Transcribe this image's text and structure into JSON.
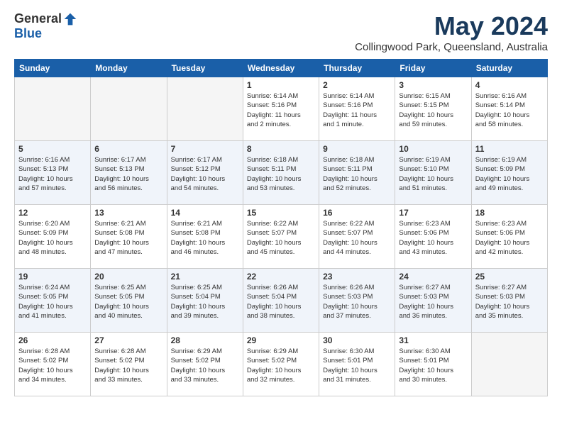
{
  "header": {
    "logo_general": "General",
    "logo_blue": "Blue",
    "month_title": "May 2024",
    "location": "Collingwood Park, Queensland, Australia"
  },
  "weekdays": [
    "Sunday",
    "Monday",
    "Tuesday",
    "Wednesday",
    "Thursday",
    "Friday",
    "Saturday"
  ],
  "weeks": [
    {
      "days": [
        {
          "num": "",
          "info": ""
        },
        {
          "num": "",
          "info": ""
        },
        {
          "num": "",
          "info": ""
        },
        {
          "num": "1",
          "info": "Sunrise: 6:14 AM\nSunset: 5:16 PM\nDaylight: 11 hours\nand 2 minutes."
        },
        {
          "num": "2",
          "info": "Sunrise: 6:14 AM\nSunset: 5:16 PM\nDaylight: 11 hours\nand 1 minute."
        },
        {
          "num": "3",
          "info": "Sunrise: 6:15 AM\nSunset: 5:15 PM\nDaylight: 10 hours\nand 59 minutes."
        },
        {
          "num": "4",
          "info": "Sunrise: 6:16 AM\nSunset: 5:14 PM\nDaylight: 10 hours\nand 58 minutes."
        }
      ]
    },
    {
      "days": [
        {
          "num": "5",
          "info": "Sunrise: 6:16 AM\nSunset: 5:13 PM\nDaylight: 10 hours\nand 57 minutes."
        },
        {
          "num": "6",
          "info": "Sunrise: 6:17 AM\nSunset: 5:13 PM\nDaylight: 10 hours\nand 56 minutes."
        },
        {
          "num": "7",
          "info": "Sunrise: 6:17 AM\nSunset: 5:12 PM\nDaylight: 10 hours\nand 54 minutes."
        },
        {
          "num": "8",
          "info": "Sunrise: 6:18 AM\nSunset: 5:11 PM\nDaylight: 10 hours\nand 53 minutes."
        },
        {
          "num": "9",
          "info": "Sunrise: 6:18 AM\nSunset: 5:11 PM\nDaylight: 10 hours\nand 52 minutes."
        },
        {
          "num": "10",
          "info": "Sunrise: 6:19 AM\nSunset: 5:10 PM\nDaylight: 10 hours\nand 51 minutes."
        },
        {
          "num": "11",
          "info": "Sunrise: 6:19 AM\nSunset: 5:09 PM\nDaylight: 10 hours\nand 49 minutes."
        }
      ]
    },
    {
      "days": [
        {
          "num": "12",
          "info": "Sunrise: 6:20 AM\nSunset: 5:09 PM\nDaylight: 10 hours\nand 48 minutes."
        },
        {
          "num": "13",
          "info": "Sunrise: 6:21 AM\nSunset: 5:08 PM\nDaylight: 10 hours\nand 47 minutes."
        },
        {
          "num": "14",
          "info": "Sunrise: 6:21 AM\nSunset: 5:08 PM\nDaylight: 10 hours\nand 46 minutes."
        },
        {
          "num": "15",
          "info": "Sunrise: 6:22 AM\nSunset: 5:07 PM\nDaylight: 10 hours\nand 45 minutes."
        },
        {
          "num": "16",
          "info": "Sunrise: 6:22 AM\nSunset: 5:07 PM\nDaylight: 10 hours\nand 44 minutes."
        },
        {
          "num": "17",
          "info": "Sunrise: 6:23 AM\nSunset: 5:06 PM\nDaylight: 10 hours\nand 43 minutes."
        },
        {
          "num": "18",
          "info": "Sunrise: 6:23 AM\nSunset: 5:06 PM\nDaylight: 10 hours\nand 42 minutes."
        }
      ]
    },
    {
      "days": [
        {
          "num": "19",
          "info": "Sunrise: 6:24 AM\nSunset: 5:05 PM\nDaylight: 10 hours\nand 41 minutes."
        },
        {
          "num": "20",
          "info": "Sunrise: 6:25 AM\nSunset: 5:05 PM\nDaylight: 10 hours\nand 40 minutes."
        },
        {
          "num": "21",
          "info": "Sunrise: 6:25 AM\nSunset: 5:04 PM\nDaylight: 10 hours\nand 39 minutes."
        },
        {
          "num": "22",
          "info": "Sunrise: 6:26 AM\nSunset: 5:04 PM\nDaylight: 10 hours\nand 38 minutes."
        },
        {
          "num": "23",
          "info": "Sunrise: 6:26 AM\nSunset: 5:03 PM\nDaylight: 10 hours\nand 37 minutes."
        },
        {
          "num": "24",
          "info": "Sunrise: 6:27 AM\nSunset: 5:03 PM\nDaylight: 10 hours\nand 36 minutes."
        },
        {
          "num": "25",
          "info": "Sunrise: 6:27 AM\nSunset: 5:03 PM\nDaylight: 10 hours\nand 35 minutes."
        }
      ]
    },
    {
      "days": [
        {
          "num": "26",
          "info": "Sunrise: 6:28 AM\nSunset: 5:02 PM\nDaylight: 10 hours\nand 34 minutes."
        },
        {
          "num": "27",
          "info": "Sunrise: 6:28 AM\nSunset: 5:02 PM\nDaylight: 10 hours\nand 33 minutes."
        },
        {
          "num": "28",
          "info": "Sunrise: 6:29 AM\nSunset: 5:02 PM\nDaylight: 10 hours\nand 33 minutes."
        },
        {
          "num": "29",
          "info": "Sunrise: 6:29 AM\nSunset: 5:02 PM\nDaylight: 10 hours\nand 32 minutes."
        },
        {
          "num": "30",
          "info": "Sunrise: 6:30 AM\nSunset: 5:01 PM\nDaylight: 10 hours\nand 31 minutes."
        },
        {
          "num": "31",
          "info": "Sunrise: 6:30 AM\nSunset: 5:01 PM\nDaylight: 10 hours\nand 30 minutes."
        },
        {
          "num": "",
          "info": ""
        }
      ]
    }
  ]
}
